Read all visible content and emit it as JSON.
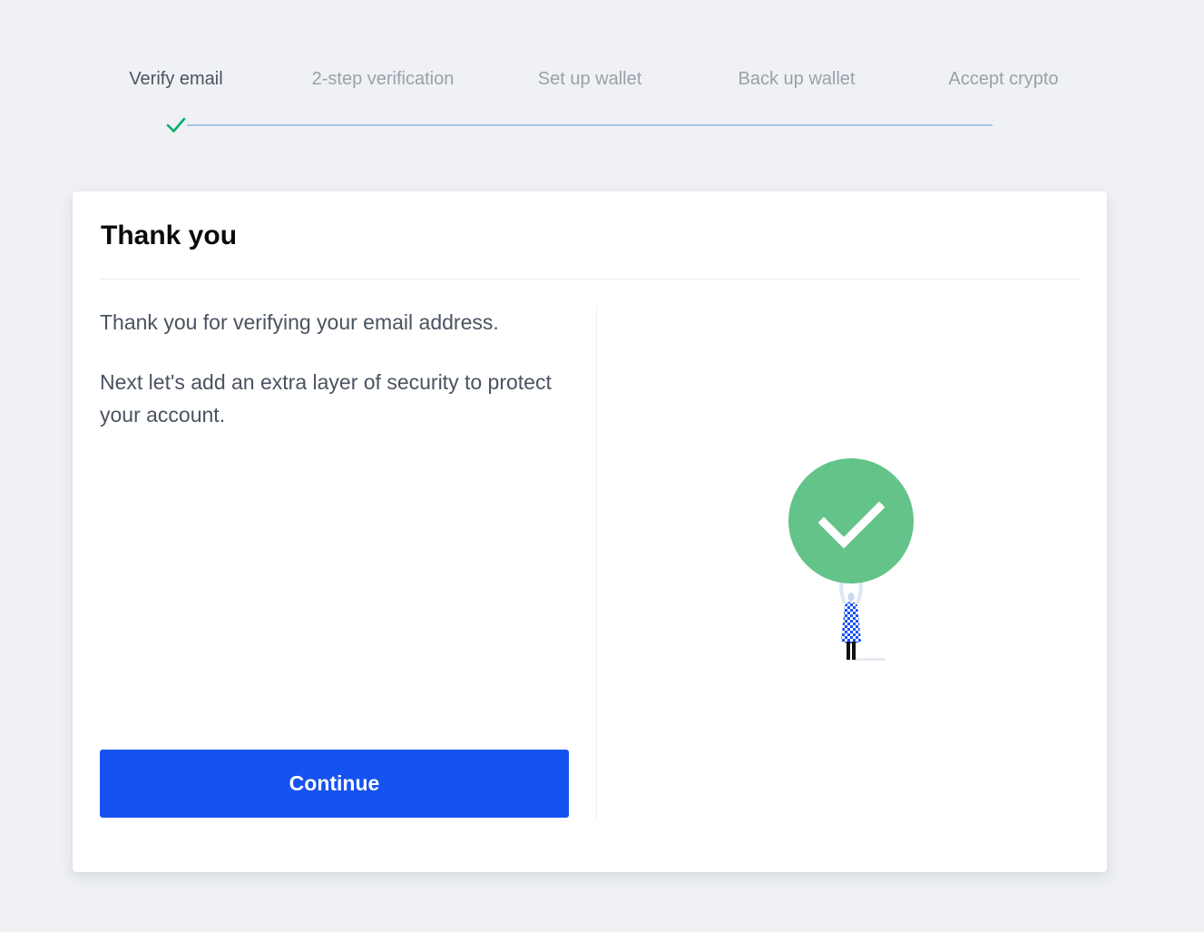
{
  "steps": [
    {
      "label": "Verify email",
      "state": "completed"
    },
    {
      "label": "2-step verification",
      "state": "pending"
    },
    {
      "label": "Set up wallet",
      "state": "pending"
    },
    {
      "label": "Back up wallet",
      "state": "pending"
    },
    {
      "label": "Accept crypto",
      "state": "pending"
    }
  ],
  "card": {
    "title": "Thank you",
    "paragraph_1": "Thank you for verifying your email address.",
    "paragraph_2": "Next let's add an extra layer of security to protect your account.",
    "continue_label": "Continue",
    "illustration": "person-holding-checkmark-icon"
  },
  "colors": {
    "accent": "#1652f0",
    "success": "#05b169",
    "illustration_green": "#63c389",
    "progress_track": "#a9c3e3",
    "background": "#eff1f4"
  }
}
